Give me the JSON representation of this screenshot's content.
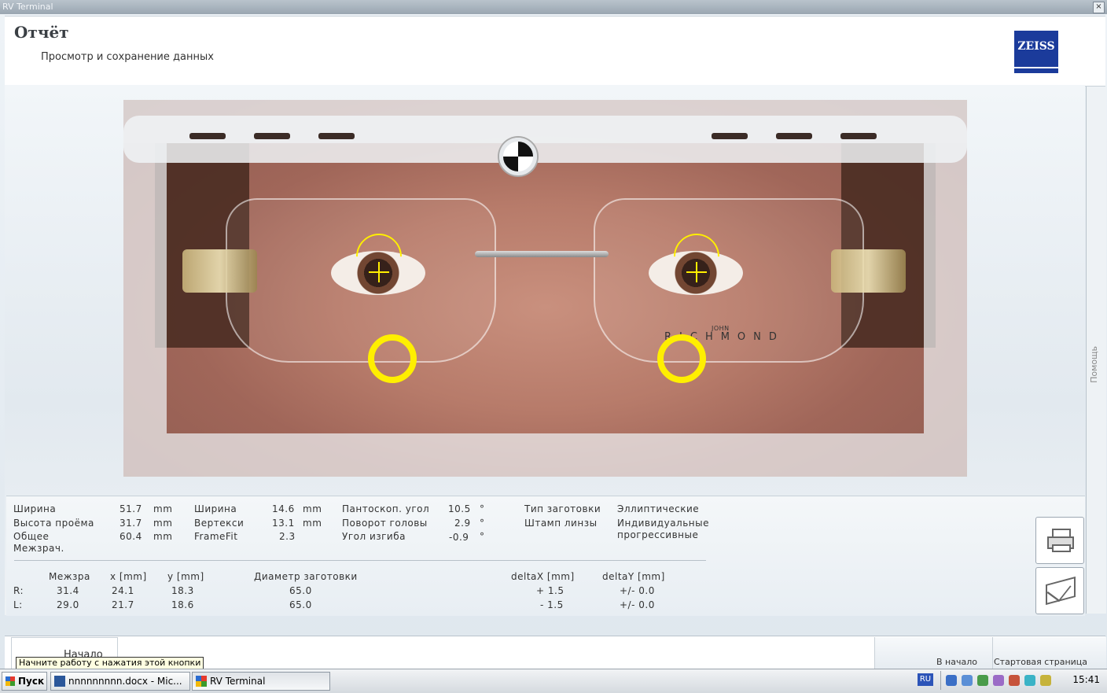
{
  "window": {
    "title": "RV Terminal",
    "close_glyph": "×"
  },
  "header": {
    "title": "Отчёт",
    "subtitle": "Просмотр и сохранение данных",
    "logo": "ZEISS"
  },
  "side": {
    "help_label": "Помощь"
  },
  "photo": {
    "brand_small": "JOHN",
    "brand_text": "RICHMOND"
  },
  "measurements": {
    "col1": [
      {
        "label": "Ширина",
        "value": "51.7",
        "unit": "mm"
      },
      {
        "label": "Высота проёма",
        "value": "31.7",
        "unit": "mm"
      },
      {
        "label": "Общее",
        "value": "60.4",
        "unit": "mm"
      },
      {
        "label": "Межзрач.",
        "value": "",
        "unit": ""
      }
    ],
    "col2": [
      {
        "label": "Ширина",
        "value": "14.6",
        "unit": "mm"
      },
      {
        "label": "Вертекси",
        "value": "13.1",
        "unit": "mm"
      },
      {
        "label": "FrameFit",
        "value": "2.3",
        "unit": ""
      }
    ],
    "col3": [
      {
        "label": "Пантоскоп. угол",
        "value": "10.5",
        "unit": "°"
      },
      {
        "label": "Поворот головы",
        "value": "2.9",
        "unit": "°"
      },
      {
        "label": "Угол изгиба",
        "value": "-0.9",
        "unit": "°"
      }
    ],
    "col4": [
      {
        "label": "Тип заготовки",
        "value": "Эллиптические"
      },
      {
        "label": "Штамп линзы",
        "value": "Индивидуальные"
      },
      {
        "label": "",
        "value": "прогрессивные"
      }
    ]
  },
  "lens_table": {
    "headers": [
      "Межзра",
      "x [mm]",
      "y [mm]",
      "Диаметр заготовки",
      "deltaX [mm]",
      "deltaY [mm]"
    ],
    "rows": [
      {
        "side": "R:",
        "pd": "31.4",
        "x": "24.1",
        "y": "18.3",
        "diameter": "65.0",
        "dx": "+ 1.5",
        "dy": "+/- 0.0"
      },
      {
        "side": "L:",
        "pd": "29.0",
        "x": "21.7",
        "y": "18.6",
        "diameter": "65.0",
        "dx": "- 1.5",
        "dy": "+/- 0.0"
      }
    ]
  },
  "nav": {
    "start_label": "Начало",
    "home_label": "В начало",
    "startpage_label": "Стартовая страница"
  },
  "tooltip": "Начните работу с нажатия этой кнопки",
  "taskbar": {
    "start": "Пуск",
    "tasks": [
      "nnnnnnnnn.docx - Mic...",
      "RV Terminal"
    ],
    "lang": "RU",
    "clock": "15:41"
  }
}
